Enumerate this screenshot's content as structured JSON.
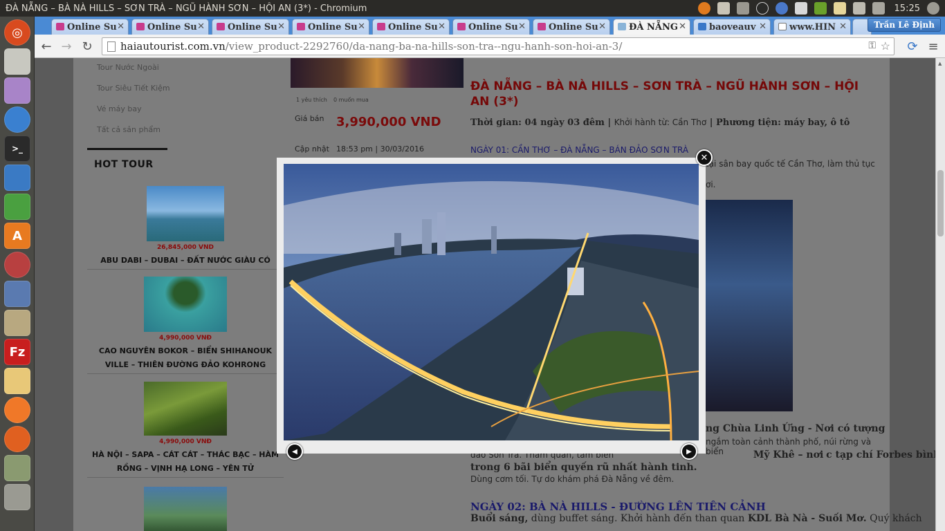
{
  "window": {
    "title": "ĐÀ NẴNG – BÀ NÀ HILLS – SƠN TRÀ – NGŨ HÀNH SƠN – HỘI AN (3*) - Chromium",
    "clock": "15:25"
  },
  "tabs": [
    {
      "label": "Online Su",
      "active": false
    },
    {
      "label": "Online Su",
      "active": false
    },
    {
      "label": "Online Su",
      "active": false
    },
    {
      "label": "Online Su",
      "active": false
    },
    {
      "label": "Online Su",
      "active": false
    },
    {
      "label": "Online Su",
      "active": false
    },
    {
      "label": "Online Su",
      "active": false
    },
    {
      "label": "ĐÀ NẴNG",
      "active": true
    },
    {
      "label": "baoveauv",
      "active": false
    },
    {
      "label": "www.HIN",
      "active": false
    }
  ],
  "user": "Trần Lê Định",
  "address": {
    "host": "haiautourist.com.vn",
    "path": "/view_product-2292760/da-nang-ba-na-hills-son-tra--ngu-hanh-son-hoi-an-3/"
  },
  "sidebar": {
    "links": [
      "Tour Nước Ngoài",
      "Tour Siêu Tiết Kiệm",
      "Vé máy bay",
      "Tất cả sản phẩm"
    ],
    "hot_title": "HOT TOUR",
    "hot_items": [
      {
        "price": "26,845,000 VND",
        "name": "ABU DABI – DUBAI – ĐẤT NƯỚC GIÀU CÓ"
      },
      {
        "price": "4,990,000 VNĐ",
        "name": "CAO NGUYÊN BOKOR – BIỂN SHIHANOUK VILLE – THIÊN ĐƯỜNG ĐẢO KOHRONG"
      },
      {
        "price": "4,990,000 VNĐ",
        "name": "HÀ NỘI – SAPA – CÁT CÁT – THÁC BẠC – HÀM RỒNG – VỊNH HẠ LONG – YÊN TỬ"
      }
    ]
  },
  "product": {
    "likes": "1 yêu thích",
    "wants": "0 muốn mua",
    "price_label": "Giá bán",
    "price": "3,990,000 VND",
    "updated_label": "Cập nhật",
    "updated": "18:53 pm | 30/03/2016",
    "title": "ĐÀ NẴNG – BÀ NÀ HILLS – SƠN TRÀ –  NGŨ HÀNH SƠN – HỘI AN (3*)",
    "meta_time": "Thời gian: 04 ngày 03 đêm",
    "meta_depart": "Khởi hành từ: Cần Thơ",
    "meta_transport": "| Phương tiện: máy bay, ô tô",
    "day1_head": "NGÀY 01: CẦN THƠ – ĐÀ NẴNG – BÁN ĐẢO SƠN TRÀ",
    "day1_line1": "tại sân bay quốc tế Cần Thơ, làm thủ tục",
    "day1_line2": "ơi.",
    "day1_p1": "ng Chùa Linh Ứng - Nơi có tượng",
    "day1_p2": "ngắm toàn cảnh thành phố, núi rừng và biển",
    "day1_p3a": "đảo Sơn Trà. Tham quan, tắm biển",
    "day1_p3b": "Mỹ Khê – nơi",
    "day1_p3c": "c tạp chí Forbes bình chọn là một",
    "day1_p4": "trong 6 bãi biển quyến rũ nhất hành tinh.",
    "day1_p5": "Dùng cơm tối. Tự do khám phá Đà Nẵng về đêm.",
    "day2_head": "NGÀY 02: BÀ NÀ HILLS - ĐƯỜNG LÊN TIÊN CẢNH",
    "day2_p1a": "Buổi sáng,",
    "day2_p1b": "dùng buffet sáng. Khởi hành đến than quan",
    "day2_p1c": "KDL Bà Nà - Suối Mơ.",
    "day2_p1d": "Quý khách"
  },
  "lightbox": {
    "close": "✕",
    "prev": "◀",
    "next": "▶"
  },
  "colors": {
    "accent_red": "#750808",
    "link_blue": "#1a1a6a",
    "tab_blue": "#4a8ad4"
  }
}
